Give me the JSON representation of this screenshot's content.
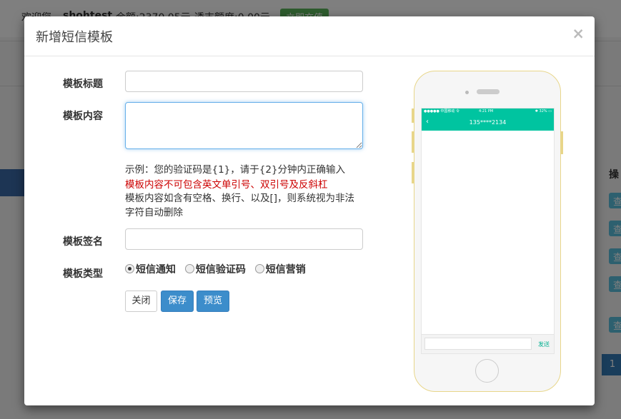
{
  "background": {
    "topbar_items": [
      "欢迎您",
      "shohtest",
      "余额:2370.05元",
      "透支额度:0.00元",
      "立即充值"
    ],
    "table_header": "操",
    "table_buttons": [
      "查",
      "查",
      "查",
      "查",
      "查"
    ],
    "page_number": "1"
  },
  "modal": {
    "title": "新增短信模板",
    "close_symbol": "×",
    "fields": {
      "title_label": "模板标题",
      "title_value": "",
      "content_label": "模板内容",
      "content_value": "",
      "signature_label": "模板签名",
      "signature_value": "",
      "type_label": "模板类型"
    },
    "hints": {
      "example": "示例：您的验证码是{1}，请于{2}分钟内正确输入",
      "warning": "模板内容不可包含英文单引号、双引号及反斜杠",
      "note_line1": "模板内容如含有空格、换行、以及[]，则系统视为非法",
      "note_line2": "字符自动删除"
    },
    "types": [
      {
        "label": "短信通知",
        "checked": true
      },
      {
        "label": "短信验证码",
        "checked": false
      },
      {
        "label": "短信营销",
        "checked": false
      }
    ],
    "buttons": {
      "close": "关闭",
      "save": "保存",
      "preview": "预览"
    }
  },
  "phone_preview": {
    "status_left": "●●●●● 中国移动 令",
    "status_time": "4:21 PM",
    "status_right": "✱ 32% ▭",
    "back_icon": "chevron-left-icon",
    "contact": "135****2134",
    "send_label": "发送",
    "accent_color": "#00c4a0"
  }
}
